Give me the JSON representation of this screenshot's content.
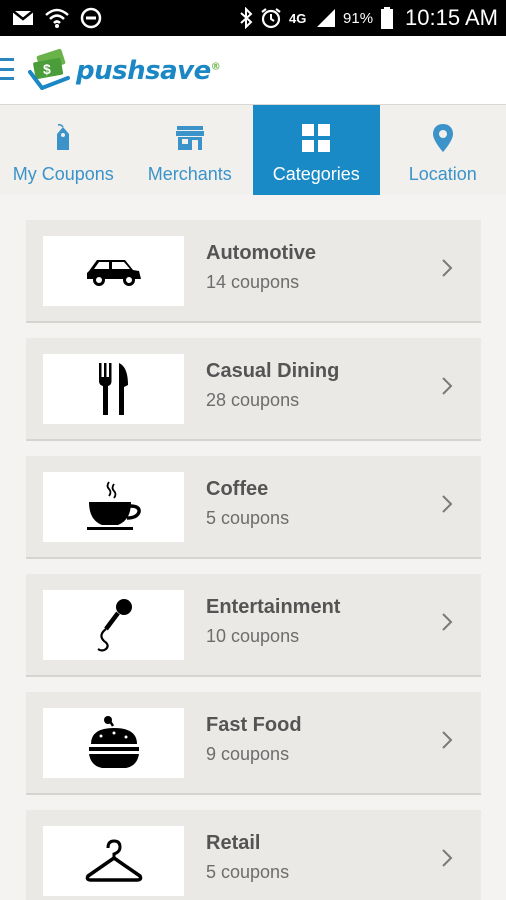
{
  "status_bar": {
    "time": "10:15 AM",
    "battery_percent": "91%",
    "icons": [
      "gmail-icon",
      "wifi-icon",
      "do-not-disturb-icon",
      "bluetooth-icon",
      "alarm-icon",
      "4g-icon",
      "signal-icon",
      "battery-icon"
    ]
  },
  "app": {
    "logo_text": "pushsave",
    "brand_color": "#1b87c4",
    "accent_color": "#6ab34a"
  },
  "tabs": [
    {
      "label": "My Coupons",
      "icon": "tag-icon",
      "active": false
    },
    {
      "label": "Merchants",
      "icon": "store-icon",
      "active": false
    },
    {
      "label": "Categories",
      "icon": "grid-icon",
      "active": true
    },
    {
      "label": "Location",
      "icon": "location-pin-icon",
      "active": false
    }
  ],
  "categories": [
    {
      "name": "Automotive",
      "count": "14 coupons",
      "icon": "car-icon"
    },
    {
      "name": "Casual Dining",
      "count": "28 coupons",
      "icon": "fork-knife-icon"
    },
    {
      "name": "Coffee",
      "count": "5 coupons",
      "icon": "coffee-cup-icon"
    },
    {
      "name": "Entertainment",
      "count": "10 coupons",
      "icon": "microphone-icon"
    },
    {
      "name": "Fast Food",
      "count": "9 coupons",
      "icon": "burger-icon"
    },
    {
      "name": "Retail",
      "count": "5 coupons",
      "icon": "hanger-icon"
    }
  ]
}
